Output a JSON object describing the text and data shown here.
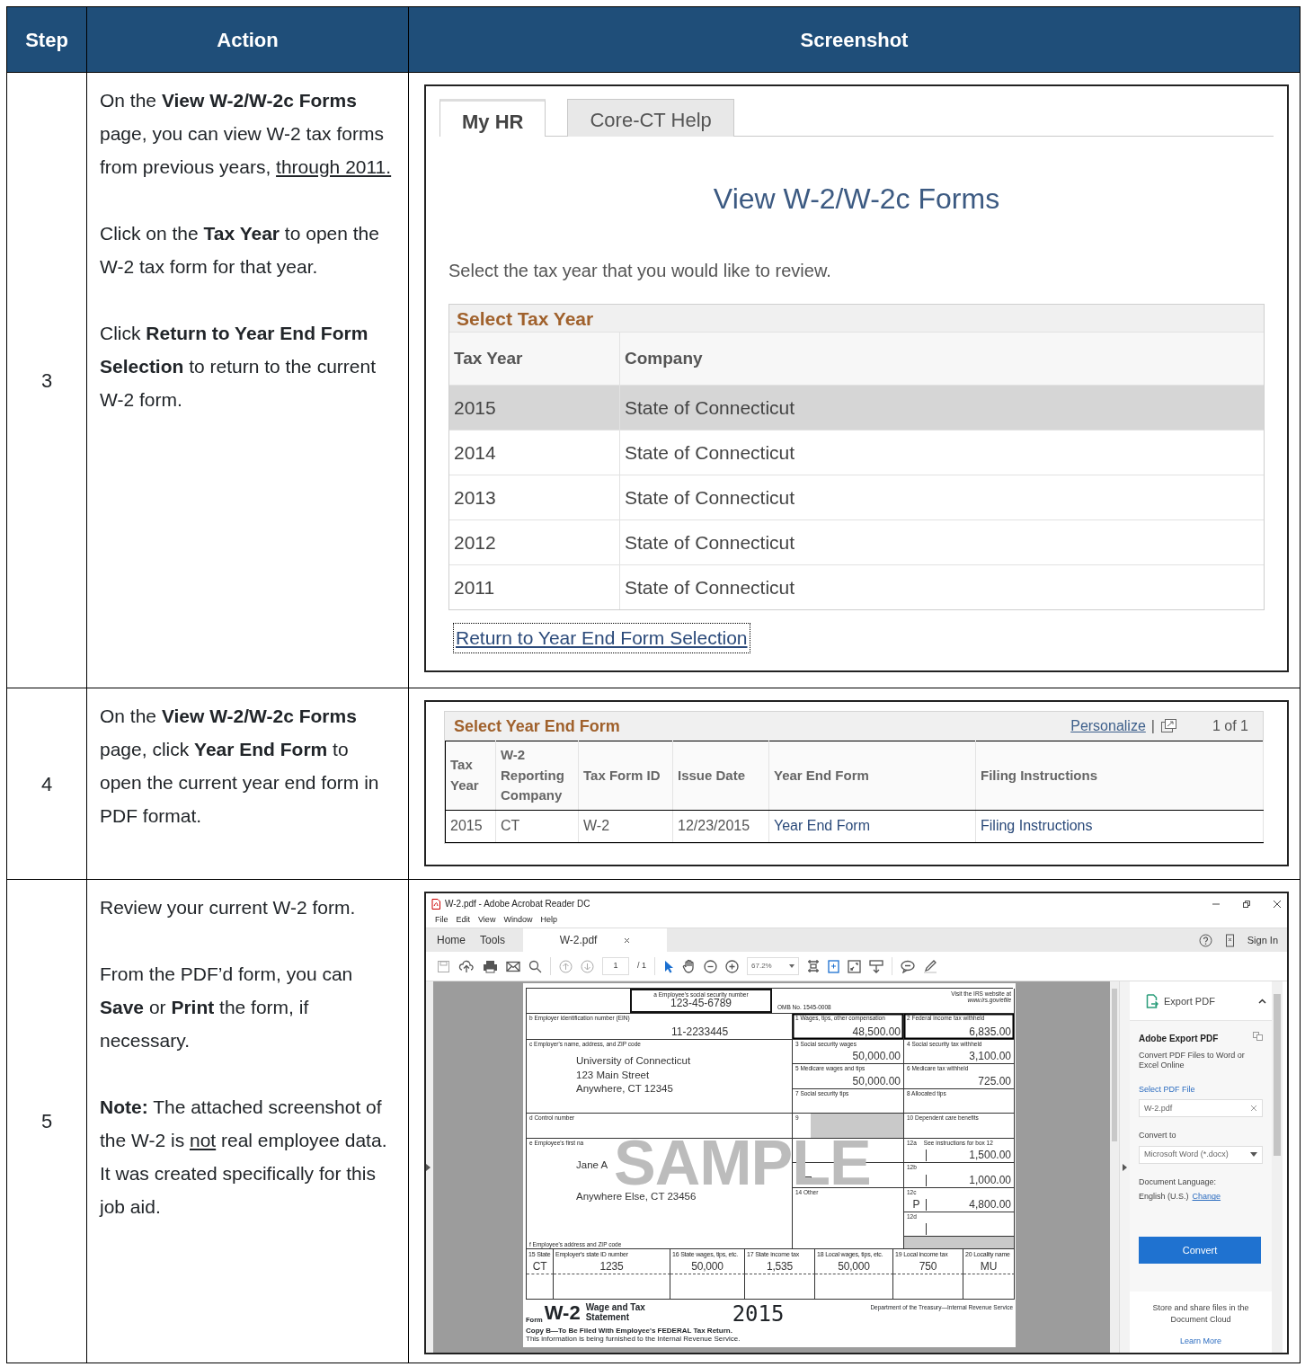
{
  "columns": [
    "Step",
    "Action",
    "Screenshot"
  ],
  "steps": [
    {
      "step": "3",
      "paragraphs": [
        [
          {
            "text": "On the **View W-2/W-2c Forms** page, you can view W-2 tax forms from previous years, ",
            "underline": false
          },
          {
            "text": "through 2011.",
            "underline": true
          }
        ],
        [
          {
            "text": "Click on the **Tax Year** to open the W-2 tax form for that year.",
            "underline": false
          }
        ],
        [
          {
            "text": "Click **Return to Year End Form Selection** to return to the current W-2 form.",
            "underline": false
          }
        ]
      ],
      "screenshot": {
        "kind": "tax_year_list",
        "tabs": [
          {
            "label": "My HR",
            "selected": true
          },
          {
            "label": "Core-CT Help",
            "selected": false
          }
        ],
        "title": "View W-2/W-2c Forms",
        "instruction": "Select the tax year that you would like to review.",
        "grid_title": "Select Tax Year",
        "columns": [
          "Tax Year",
          "Company"
        ],
        "rows": [
          {
            "year": "2015",
            "company": "State of Connecticut",
            "selected": true
          },
          {
            "year": "2014",
            "company": "State of Connecticut",
            "selected": false
          },
          {
            "year": "2013",
            "company": "State of Connecticut",
            "selected": false
          },
          {
            "year": "2012",
            "company": "State of Connecticut",
            "selected": false
          },
          {
            "year": "2011",
            "company": "State of Connecticut",
            "selected": false
          }
        ],
        "link": "Return to Year End Form Selection",
        "link_focused": true
      }
    },
    {
      "step": "4",
      "paragraphs": [
        [
          {
            "text": "On the **View W-2/W-2c Forms** page, click **Year End Form** to open the current year end form in PDF format.",
            "underline": false
          }
        ]
      ],
      "screenshot": {
        "kind": "year_end_forms",
        "grid_title": "Select Year End Form",
        "personalize": "Personalize",
        "separator": "|",
        "count": "1 of 1",
        "columns": [
          "Tax Year",
          "W-2 Reporting Company",
          "Tax Form ID",
          "Issue Date",
          "Year End Form",
          "Filing Instructions"
        ],
        "rows": [
          {
            "cells": [
              {
                "text": "2015",
                "link": false
              },
              {
                "text": "CT",
                "link": false
              },
              {
                "text": "W-2",
                "link": false
              },
              {
                "text": "12/23/2015",
                "link": false
              },
              {
                "text": "Year End Form",
                "link": true
              },
              {
                "text": "Filing Instructions",
                "link": true
              }
            ]
          }
        ]
      }
    },
    {
      "step": "5",
      "paragraphs": [
        [
          {
            "text": "Review your current W-2 form.",
            "underline": false
          }
        ],
        [
          {
            "text": "From the PDF’d form, you can **Save** or **Print** the form, if necessary.",
            "underline": false
          }
        ],
        [
          {
            "text": "**Note:** The attached screenshot of the W-2 is ",
            "underline": false
          },
          {
            "text": "not",
            "underline": true
          },
          {
            "text": " real employee data. It was created specifically for this job aid.",
            "underline": false
          }
        ]
      ],
      "screenshot": {
        "kind": "pdf_viewer",
        "title": "W-2.pdf - Adobe Acrobat Reader DC",
        "menu": [
          "File",
          "Edit",
          "View",
          "Window",
          "Help"
        ],
        "tabs": [
          {
            "label": "Home",
            "selected": false,
            "closable": false
          },
          {
            "label": "Tools",
            "selected": false,
            "closable": false
          },
          {
            "label": "W-2.pdf",
            "selected": true,
            "closable": true
          }
        ],
        "sign_in": "Sign In",
        "page": "1",
        "page_total": "/ 1",
        "zoom": "67.2%",
        "w2": {
          "ssn_label": "a Employee's social security number",
          "ssn": "123-45-6789",
          "omb": "OMB No. 1545-0008",
          "irs_note": "Visit the IRS website at",
          "irs_site": "www.irs.gov/efile",
          "ein_label": "b Employer identification number (EIN)",
          "ein": "11-2233445",
          "employer_label": "c Employer's name, address, and ZIP code",
          "employer_lines": [
            "University of Connecticut",
            "123 Main Street",
            "Anywhere, CT 12345"
          ],
          "control_label": "d Control number",
          "employee_label": "e Employee's first na",
          "employee_lines": [
            "Jane A",
            "Anywhere Else, CT 23456"
          ],
          "address_label": "f Employee's address and ZIP code",
          "boxes": [
            {
              "kind": "amount",
              "label": "1 Wages, tips, other compensation",
              "value": "48,500.00",
              "emphasized": true
            },
            {
              "kind": "amount",
              "label": "2 Federal income tax withheld",
              "value": "6,835.00",
              "emphasized": true
            },
            {
              "kind": "amount",
              "label": "3 Social security wages",
              "value": "50,000.00",
              "emphasized": false
            },
            {
              "kind": "amount",
              "label": "4 Social security tax withheld",
              "value": "3,100.00",
              "emphasized": false
            },
            {
              "kind": "amount",
              "label": "5 Medicare wages and tips",
              "value": "50,000.00",
              "emphasized": false
            },
            {
              "kind": "amount",
              "label": "6 Medicare tax withheld",
              "value": "725.00",
              "emphasized": false
            },
            {
              "kind": "amount",
              "label": "7 Social security tips",
              "emphasized": false
            },
            {
              "kind": "amount",
              "label": "8 Allocated tips",
              "emphasized": false
            },
            {
              "kind": "shaded",
              "label": "9"
            },
            {
              "kind": "amount",
              "label": "10 Dependent care benefits",
              "emphasized": false
            },
            {
              "kind": "amount",
              "emphasized": false
            },
            {
              "kind": "coded",
              "label": "12a",
              "note": "See instructions for box 12",
              "value": "1,500.00"
            },
            {
              "kind": "checkbox",
              "checked": false
            },
            {
              "kind": "coded",
              "label": "12b",
              "value": "1,000.00"
            },
            {
              "kind": "amount",
              "label": "14 Other",
              "emphasized": false
            },
            {
              "kind": "coded",
              "label": "12c",
              "code": "P",
              "value": "4,800.00"
            },
            {
              "kind": "coded",
              "label": "12d"
            },
            {
              "kind": "shaded"
            }
          ],
          "state_boxes": [
            {
              "label": "15 State",
              "value": "CT"
            },
            {
              "label": "Employer's state ID number",
              "value": "1235"
            },
            {
              "label": "16 State wages, tips, etc.",
              "value": "50,000"
            },
            {
              "label": "17 State income tax",
              "value": "1,535"
            },
            {
              "label": "18 Local wages, tips, etc.",
              "value": "50,000"
            },
            {
              "label": "19 Local income tax",
              "value": "750"
            },
            {
              "label": "20 Locality name",
              "value": "MU"
            }
          ],
          "form_word": "Form",
          "form_code": "W-2",
          "form_title": "Wage and Tax Statement",
          "year": "2015",
          "department": "Department of the Treasury—Internal Revenue Service",
          "copy": "Copy B—To Be Filed With Employee's FEDERAL Tax Return.",
          "info": "This information is being furnished to the Internal Revenue Service.",
          "stamp": "SAMPLE"
        },
        "panel": {
          "title": "Export PDF",
          "expanded": true,
          "heading": "Adobe Export PDF",
          "description": "Convert PDF Files to Word or Excel Online",
          "file_label": "Select PDF File",
          "file": "W-2.pdf",
          "convert_label": "Convert to",
          "format": "Microsoft Word (*.docx)",
          "language_label": "Document Language:",
          "language": "English (U.S.)",
          "change": "Change",
          "button": "Convert",
          "cloud_text": "Store and share files in the Document Cloud",
          "learn_more": "Learn More"
        }
      }
    }
  ]
}
